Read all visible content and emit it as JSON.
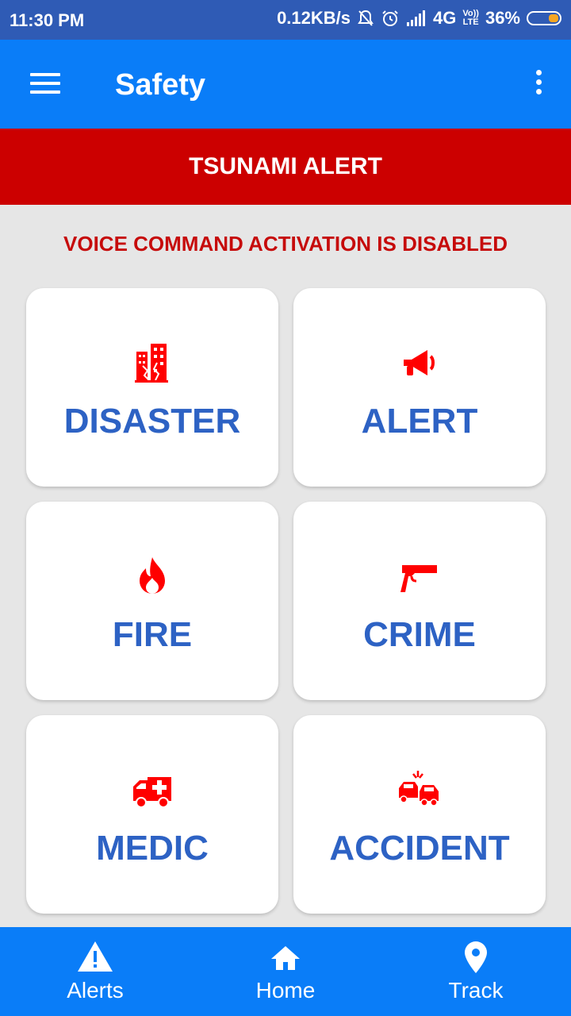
{
  "status_bar": {
    "time": "11:30 PM",
    "speed": "0.12KB/s",
    "network": "4G",
    "volte_top": "Vo))",
    "volte_bottom": "LTE",
    "battery": "36%"
  },
  "app_bar": {
    "title": "Safety"
  },
  "banner": {
    "text": "TSUNAMI ALERT"
  },
  "voice_status": "VOICE COMMAND ACTIVATION IS DISABLED",
  "tiles": [
    {
      "label": "DISASTER",
      "icon": "building-collapse-icon"
    },
    {
      "label": "ALERT",
      "icon": "megaphone-icon"
    },
    {
      "label": "FIRE",
      "icon": "flame-icon"
    },
    {
      "label": "CRIME",
      "icon": "gun-icon"
    },
    {
      "label": "MEDIC",
      "icon": "ambulance-icon"
    },
    {
      "label": "ACCIDENT",
      "icon": "car-crash-icon"
    }
  ],
  "bottom_nav": [
    {
      "label": "Alerts",
      "icon": "warning-icon"
    },
    {
      "label": "Home",
      "icon": "home-icon"
    },
    {
      "label": "Track",
      "icon": "location-pin-icon"
    }
  ],
  "colors": {
    "primary": "#0a7df8",
    "banner": "#cc0000",
    "tile_text": "#2d62c4",
    "icon_red": "#ff0000"
  }
}
